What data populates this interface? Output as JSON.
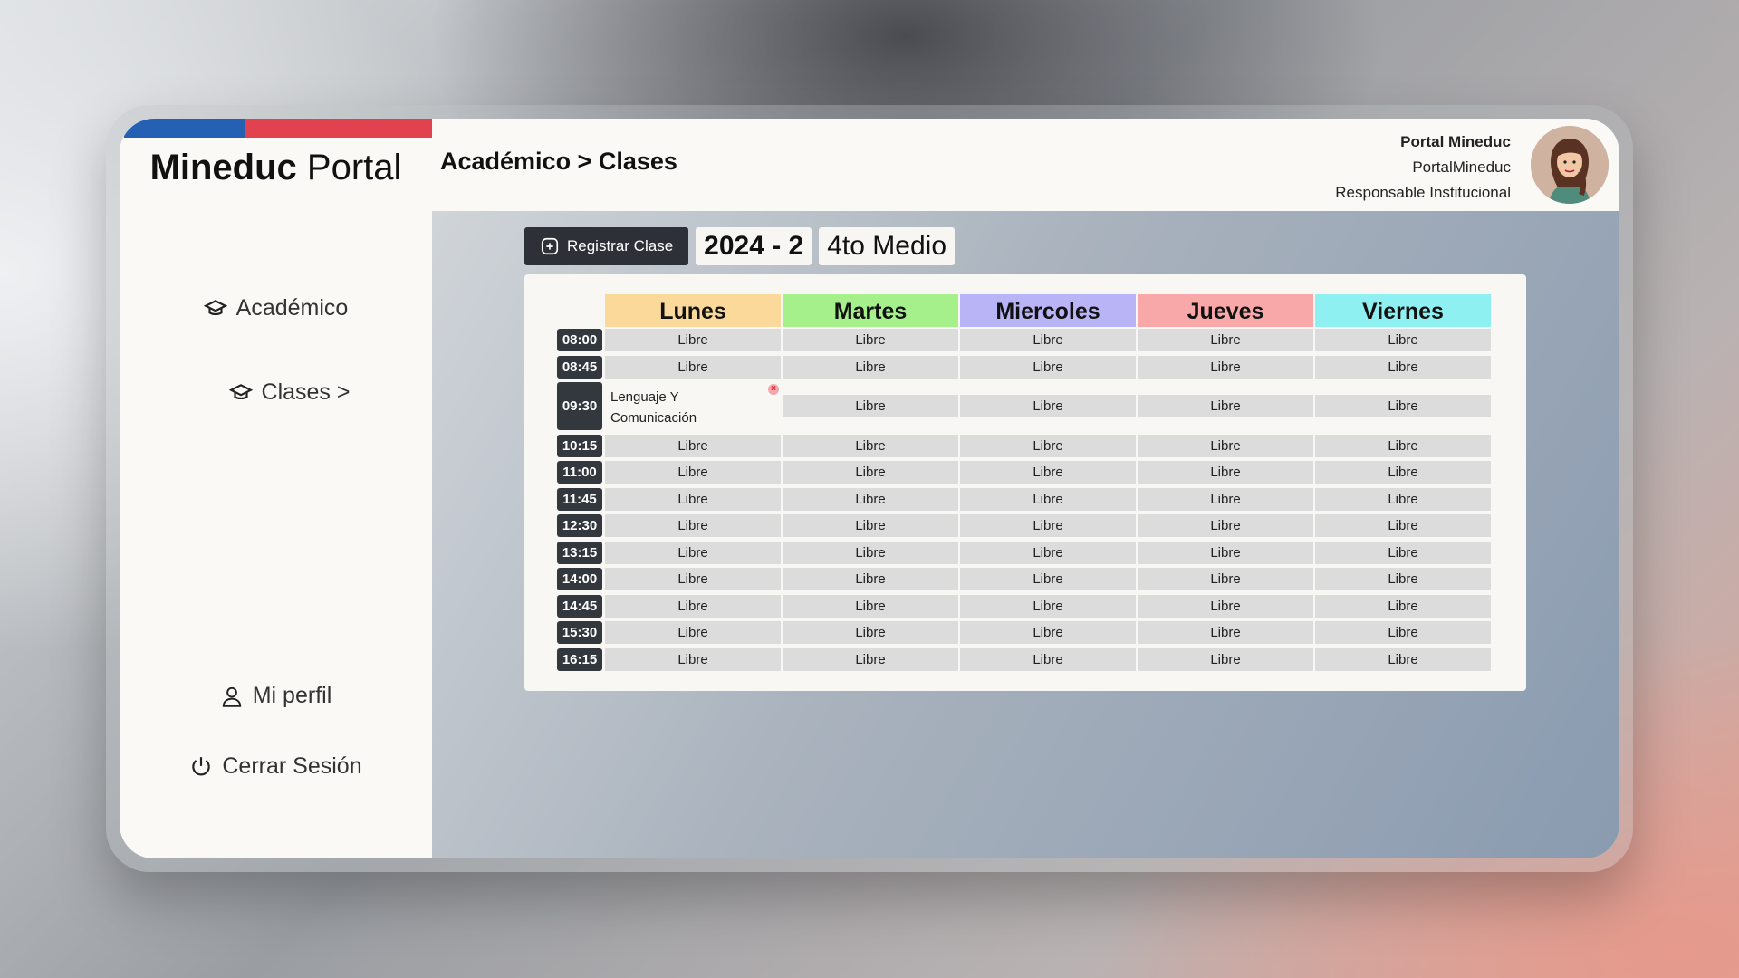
{
  "brand": {
    "bold": "Mineduc",
    "light": "Portal"
  },
  "sidebar": {
    "items": [
      {
        "label": "Académico",
        "icon": "graduation-cap-icon"
      },
      {
        "label": "Clases >",
        "icon": "graduation-cap-icon"
      }
    ],
    "bottom": [
      {
        "label": "Mi perfil",
        "icon": "user-icon"
      },
      {
        "label": "Cerrar Sesión",
        "icon": "power-icon"
      }
    ]
  },
  "header": {
    "breadcrumb": "Académico > Clases",
    "user_title": "Portal Mineduc",
    "username": "PortalMineduc",
    "role": "Responsable Institucional"
  },
  "toolbar": {
    "register_label": "Registrar Clase",
    "period": "2024 - 2",
    "course": "4to Medio"
  },
  "schedule": {
    "days": [
      {
        "name": "Lunes",
        "color": "#fbd99a"
      },
      {
        "name": "Martes",
        "color": "#a6f08c"
      },
      {
        "name": "Miercoles",
        "color": "#b9b4f6"
      },
      {
        "name": "Jueves",
        "color": "#f8a8a8"
      },
      {
        "name": "Viernes",
        "color": "#8ef0f0"
      }
    ],
    "times": [
      "08:00",
      "08:45",
      "09:30",
      "10:15",
      "11:00",
      "11:45",
      "12:30",
      "13:15",
      "14:00",
      "14:45",
      "15:30",
      "16:15"
    ],
    "free_label": "Libre",
    "classes": [
      {
        "day": 0,
        "time": "09:30",
        "line1": "Lenguaje Y",
        "line2": "Comunicación"
      }
    ]
  }
}
